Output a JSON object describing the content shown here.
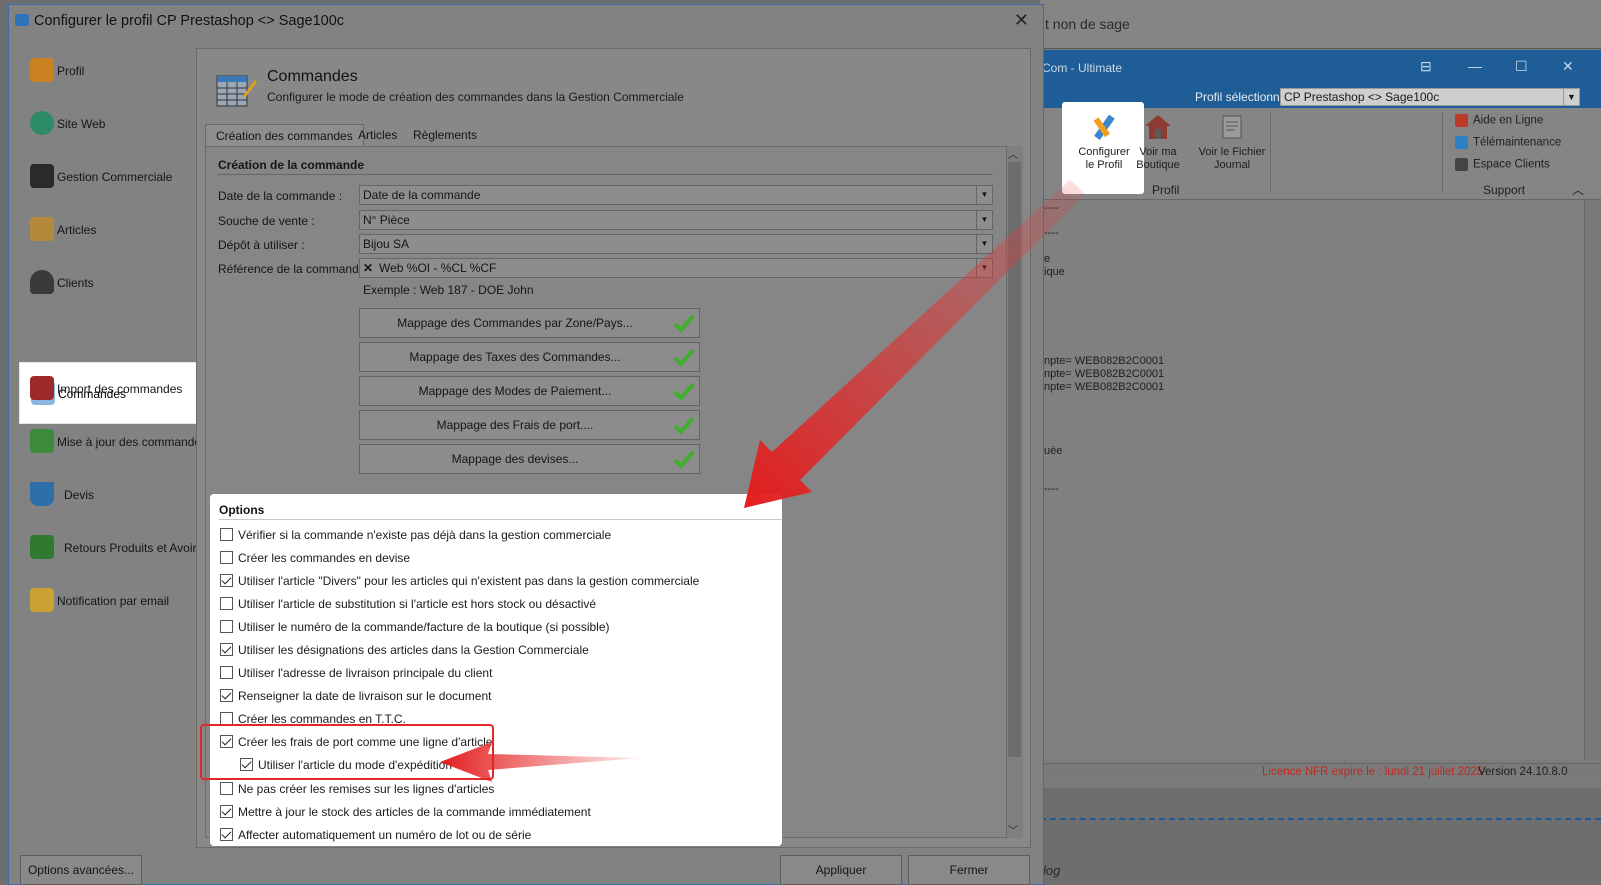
{
  "background_app": {
    "top_text": "t non de sage",
    "window_title": "Com - Ultimate",
    "profile_label": "Profil sélectionné",
    "profile_value": "CP Prestashop <> Sage100c",
    "ribbon": {
      "configure_label_1": "Configurer",
      "configure_label_2": "le Profil",
      "shop_label_1": "Voir ma",
      "shop_label_2": "Boutique",
      "journal_label_1": "Voir le Fichier",
      "journal_label_2": "Journal",
      "group_profil": "Profil",
      "support_items": [
        "Aide en Ligne",
        "Télémaintenance",
        "Espace Clients"
      ],
      "group_support": "Support"
    },
    "log_lines": [
      "----",
      "----",
      "e",
      "ique",
      "npte= WEB082B2C0001",
      "npte= WEB082B2C0001",
      "npte= WEB082B2C0001",
      "uée",
      "----"
    ],
    "license_text": "Licence NFR expire le : lundi 21 juillet 2025",
    "version_text": "Version 24.10.8.0",
    "blog_text": "log",
    "colors": {
      "titlebar": "#1f5d96",
      "license": "#c0291f"
    }
  },
  "dialog": {
    "title": "Configurer le profil CP Prestashop <> Sage100c",
    "close_glyph": "✕",
    "nav": [
      {
        "label": "Profil",
        "icon": "briefcase-icon"
      },
      {
        "label": "Site Web",
        "icon": "globe-icon"
      },
      {
        "label": "Gestion Commerciale",
        "icon": "wallet-icon"
      },
      {
        "label": "Articles",
        "icon": "boxes-icon"
      },
      {
        "label": "Clients",
        "icon": "person-icon"
      },
      {
        "label": "Commandes",
        "icon": "order-sheet-icon"
      },
      {
        "label": "Import des commandes",
        "icon": "sales-tag-icon"
      },
      {
        "label": "Mise à jour des commandes",
        "icon": "refresh-arrows-icon"
      },
      {
        "label": "Devis",
        "icon": "basket-icon"
      },
      {
        "label": "Retours Produits et Avoirs",
        "icon": "return-arrow-icon"
      },
      {
        "label": "Notification par email",
        "icon": "envelope-icon"
      }
    ],
    "active_nav": "Commandes",
    "advanced_button": "Options avancées...",
    "apply_button": "Appliquer",
    "close_button": "Fermer",
    "header": {
      "title": "Commandes",
      "subtitle": "Configurer le mode de création des commandes dans la Gestion Commerciale"
    },
    "tabs": [
      "Création des commandes",
      "Articles",
      "Règlements"
    ],
    "creation": {
      "section_title": "Création de la commande",
      "fields": [
        {
          "label": "Date de la commande :",
          "value": "Date de la commande"
        },
        {
          "label": "Souche de vente :",
          "value": "N° Pièce"
        },
        {
          "label": "Dépôt à utiliser :",
          "value": "Bijou SA"
        },
        {
          "label": "Référence de la commande :",
          "value": "Web %OI - %CL %CF"
        }
      ],
      "example": "Exemple : Web 187 - DOE John",
      "mapping_buttons": [
        "Mappage des Commandes par Zone/Pays...",
        "Mappage des Taxes des Commandes...",
        "Mappage des Modes de Paiement...",
        "Mappage des Frais de port....",
        "Mappage des devises..."
      ]
    },
    "options": {
      "title": "Options",
      "items": [
        {
          "label": "Vérifier si la commande n'existe pas déjà dans la gestion commerciale",
          "checked": false
        },
        {
          "label": "Créer les commandes en devise",
          "checked": false
        },
        {
          "label": "Utiliser l'article \"Divers\" pour les articles qui n'existent pas dans la gestion commerciale",
          "checked": true
        },
        {
          "label": "Utiliser l'article de substitution si l'article est hors stock ou désactivé",
          "checked": false
        },
        {
          "label": "Utiliser le numéro de la commande/facture de la boutique (si possible)",
          "checked": false
        },
        {
          "label": "Utiliser les désignations des articles dans la Gestion Commerciale",
          "checked": true
        },
        {
          "label": "Utiliser l'adresse de livraison principale du client",
          "checked": false
        },
        {
          "label": "Renseigner la date de livraison sur le document",
          "checked": true
        },
        {
          "label": "Créer les commandes en T.T.C.",
          "checked": false
        },
        {
          "label": "Créer les frais de port comme une ligne d'article",
          "checked": true
        },
        {
          "label": "Utiliser l'article du mode d'expédition",
          "checked": true,
          "indent": true
        },
        {
          "label": "Ne pas créer les remises sur les lignes d'articles",
          "checked": false
        },
        {
          "label": "Mettre à jour le stock des articles de la commande immédiatement",
          "checked": true
        },
        {
          "label": "Affecter automatiquement un numéro de lot ou de série",
          "checked": true
        }
      ]
    },
    "colors": {
      "highlight_red": "#e3282a",
      "check_green": "#3fae2a"
    }
  }
}
